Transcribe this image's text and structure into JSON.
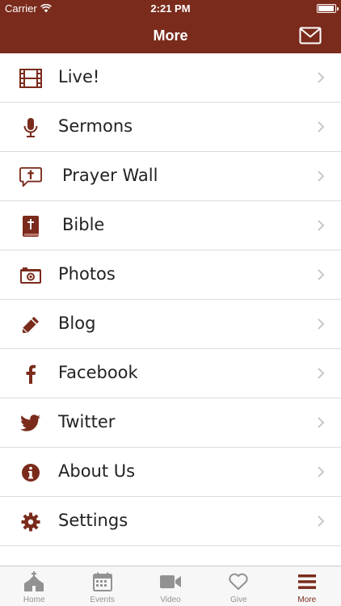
{
  "status_bar": {
    "carrier": "Carrier",
    "time": "2:21 PM"
  },
  "nav": {
    "title": "More",
    "right_icon": "mail-icon"
  },
  "menu": {
    "items": [
      {
        "label": "Live!",
        "icon": "film-icon"
      },
      {
        "label": "Sermons",
        "icon": "microphone-icon"
      },
      {
        "label": "Prayer Wall",
        "icon": "prayer-bubble-icon"
      },
      {
        "label": "Bible",
        "icon": "bible-icon"
      },
      {
        "label": "Photos",
        "icon": "camera-icon"
      },
      {
        "label": "Blog",
        "icon": "pencil-icon"
      },
      {
        "label": "Facebook",
        "icon": "facebook-icon"
      },
      {
        "label": "Twitter",
        "icon": "twitter-icon"
      },
      {
        "label": "About Us",
        "icon": "info-icon"
      },
      {
        "label": "Settings",
        "icon": "gear-icon"
      }
    ]
  },
  "tab_bar": {
    "tabs": [
      {
        "label": "Home",
        "icon": "church-icon",
        "active": false
      },
      {
        "label": "Events",
        "icon": "calendar-icon",
        "active": false
      },
      {
        "label": "Video",
        "icon": "video-camera-icon",
        "active": false
      },
      {
        "label": "Give",
        "icon": "heart-icon",
        "active": false
      },
      {
        "label": "More",
        "icon": "hamburger-icon",
        "active": true
      }
    ]
  },
  "colors": {
    "brand": "#7a2b1c",
    "icon": "#7a2b1c",
    "tab_inactive": "#929292",
    "separator": "#dcdcdc"
  }
}
